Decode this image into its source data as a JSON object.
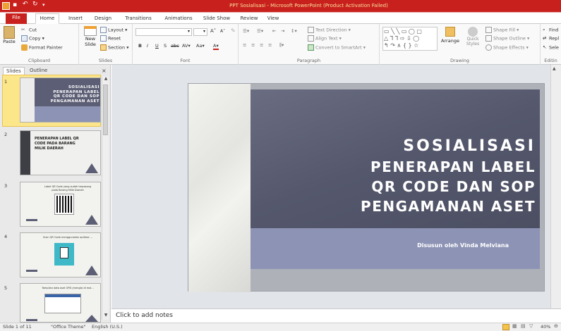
{
  "window": {
    "title": "PPT Sosialisasi - Microsoft PowerPoint (Product Activation Failed)",
    "brand_color": "#c8201c"
  },
  "ribbon_tabs": [
    "File",
    "Home",
    "Insert",
    "Design",
    "Transitions",
    "Animations",
    "Slide Show",
    "Review",
    "View"
  ],
  "clipboard": {
    "cut": "Cut",
    "copy": "Copy",
    "paste": "Paste",
    "format_painter": "Format Painter",
    "label": "Clipboard"
  },
  "slides_group": {
    "new_slide_1": "New",
    "new_slide_2": "Slide",
    "layout": "Layout",
    "reset": "Reset",
    "section": "Section",
    "label": "Slides"
  },
  "font_group": {
    "label": "Font",
    "size_up": "A",
    "size_down": "A",
    "case": "Aa",
    "bold": "B",
    "italic": "I",
    "underline": "U",
    "strike": "S",
    "abc": "abc",
    "av": "AV",
    "color_a": "A"
  },
  "paragraph_group": {
    "text_direction": "Text Direction",
    "align_text": "Align Text",
    "smartart": "Convert to SmartArt",
    "label": "Paragraph"
  },
  "drawing_group": {
    "arrange": "Arrange",
    "quick_1": "Quick",
    "quick_2": "Styles",
    "shape_fill": "Shape Fill",
    "shape_outline": "Shape Outline",
    "shape_effects": "Shape Effects",
    "label": "Drawing"
  },
  "editing_group": {
    "find": "Find",
    "replace": "Repl",
    "select": "Sele",
    "label": "Editin"
  },
  "left_pane": {
    "tab_slides": "Slides",
    "tab_outline": "Outline",
    "close": "×"
  },
  "thumbnails": [
    {
      "num": "1",
      "lines": [
        "SOSIALISASI",
        "PENERAPAN LABEL",
        "QR CODE DAN SOP",
        "PENGAMANAN ASET"
      ]
    },
    {
      "num": "2",
      "lines": [
        "PENERAPAN LABEL QR",
        "CODE PADA BARANG",
        "MILIK DAERAH"
      ]
    },
    {
      "num": "3",
      "lines": [
        "Label QR Code yang sudah terpasang",
        "pada Barang Milik Daerah"
      ]
    },
    {
      "num": "4",
      "lines": [
        "Scan QR Code menggunakan aplikasi ..."
      ]
    },
    {
      "num": "5",
      "lines": [
        "Tampilan data aset OPD (mengisi di mai..."
      ]
    }
  ],
  "slide": {
    "title_lines": [
      "SOSIALISASI",
      "PENERAPAN LABEL",
      "QR CODE DAN SOP",
      "PENGAMANAN ASET"
    ],
    "subtitle": "Disusun oleh Vinda Melviana",
    "dark_color": "#5b5e74",
    "band_color": "#8d93b5"
  },
  "notes": {
    "placeholder": "Click to add notes"
  },
  "status": {
    "slide_info": "Slide 1 of 11",
    "theme": "\"Office Theme\"",
    "language": "English (U.S.)",
    "zoom": "40%"
  }
}
